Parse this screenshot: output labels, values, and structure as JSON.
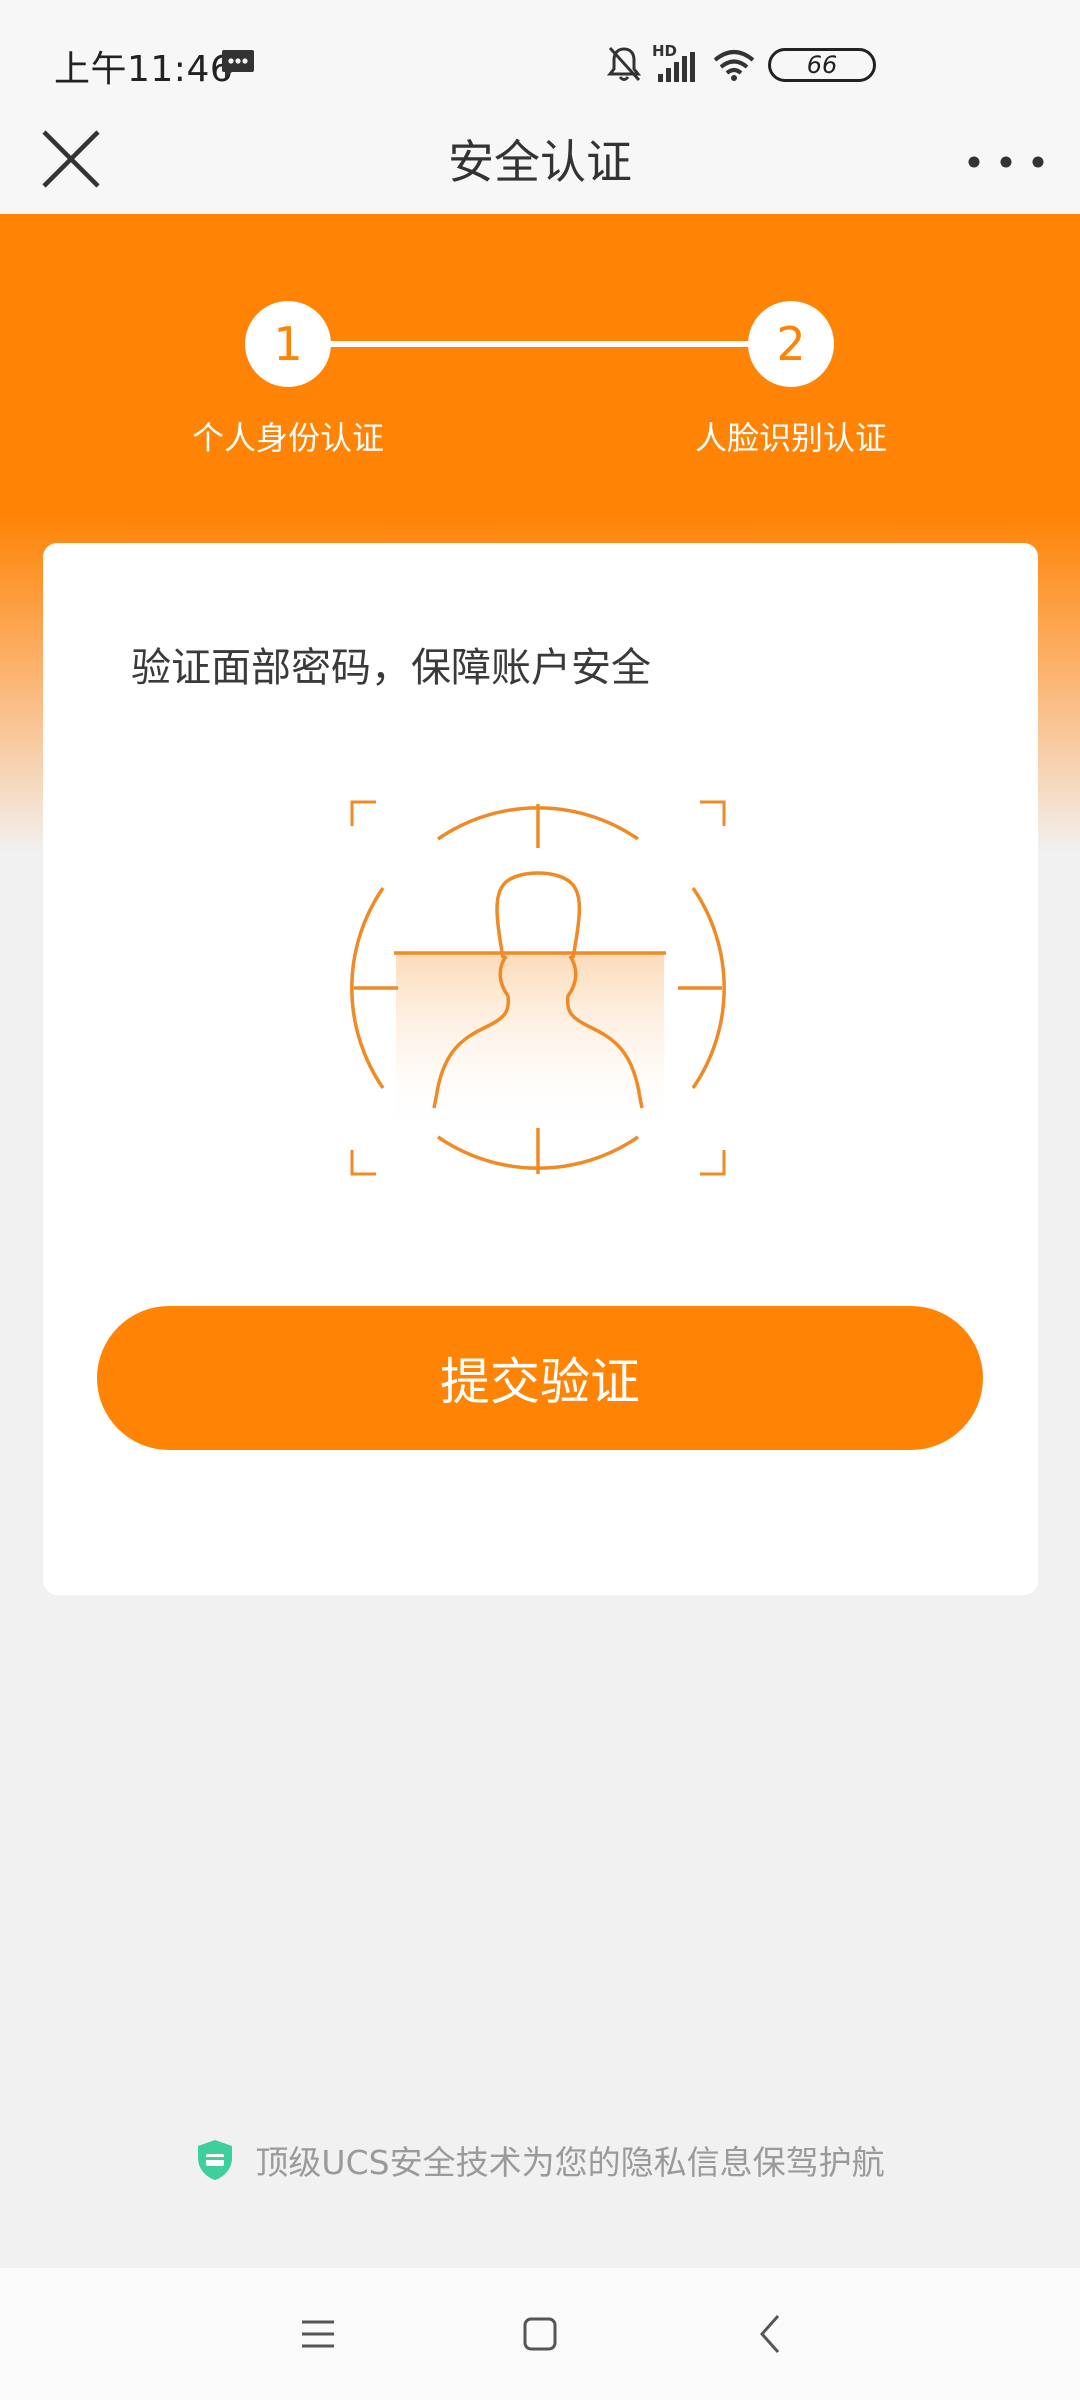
{
  "status_bar": {
    "time": "上午11:46",
    "battery": "66",
    "network_label": "HD",
    "icons": [
      "message-icon",
      "mute-bell-icon",
      "signal-icon",
      "wifi-icon",
      "battery-icon"
    ]
  },
  "header": {
    "title": "安全认证",
    "close_icon": "close-icon",
    "more_icon": "more-dots-icon"
  },
  "steps": [
    {
      "number": "1",
      "label": "个人身份认证"
    },
    {
      "number": "2",
      "label": "人脸识别认证"
    }
  ],
  "card": {
    "description": "验证面部密码，保障账户安全",
    "submit_label": "提交验证"
  },
  "footer": {
    "note": "顶级UCS安全技术为您的隐私信息保驾护航",
    "shield_icon": "shield-icon"
  },
  "colors": {
    "accent": "#ff8305",
    "background": "#f1f1f1",
    "shield": "#3fcf9c"
  }
}
